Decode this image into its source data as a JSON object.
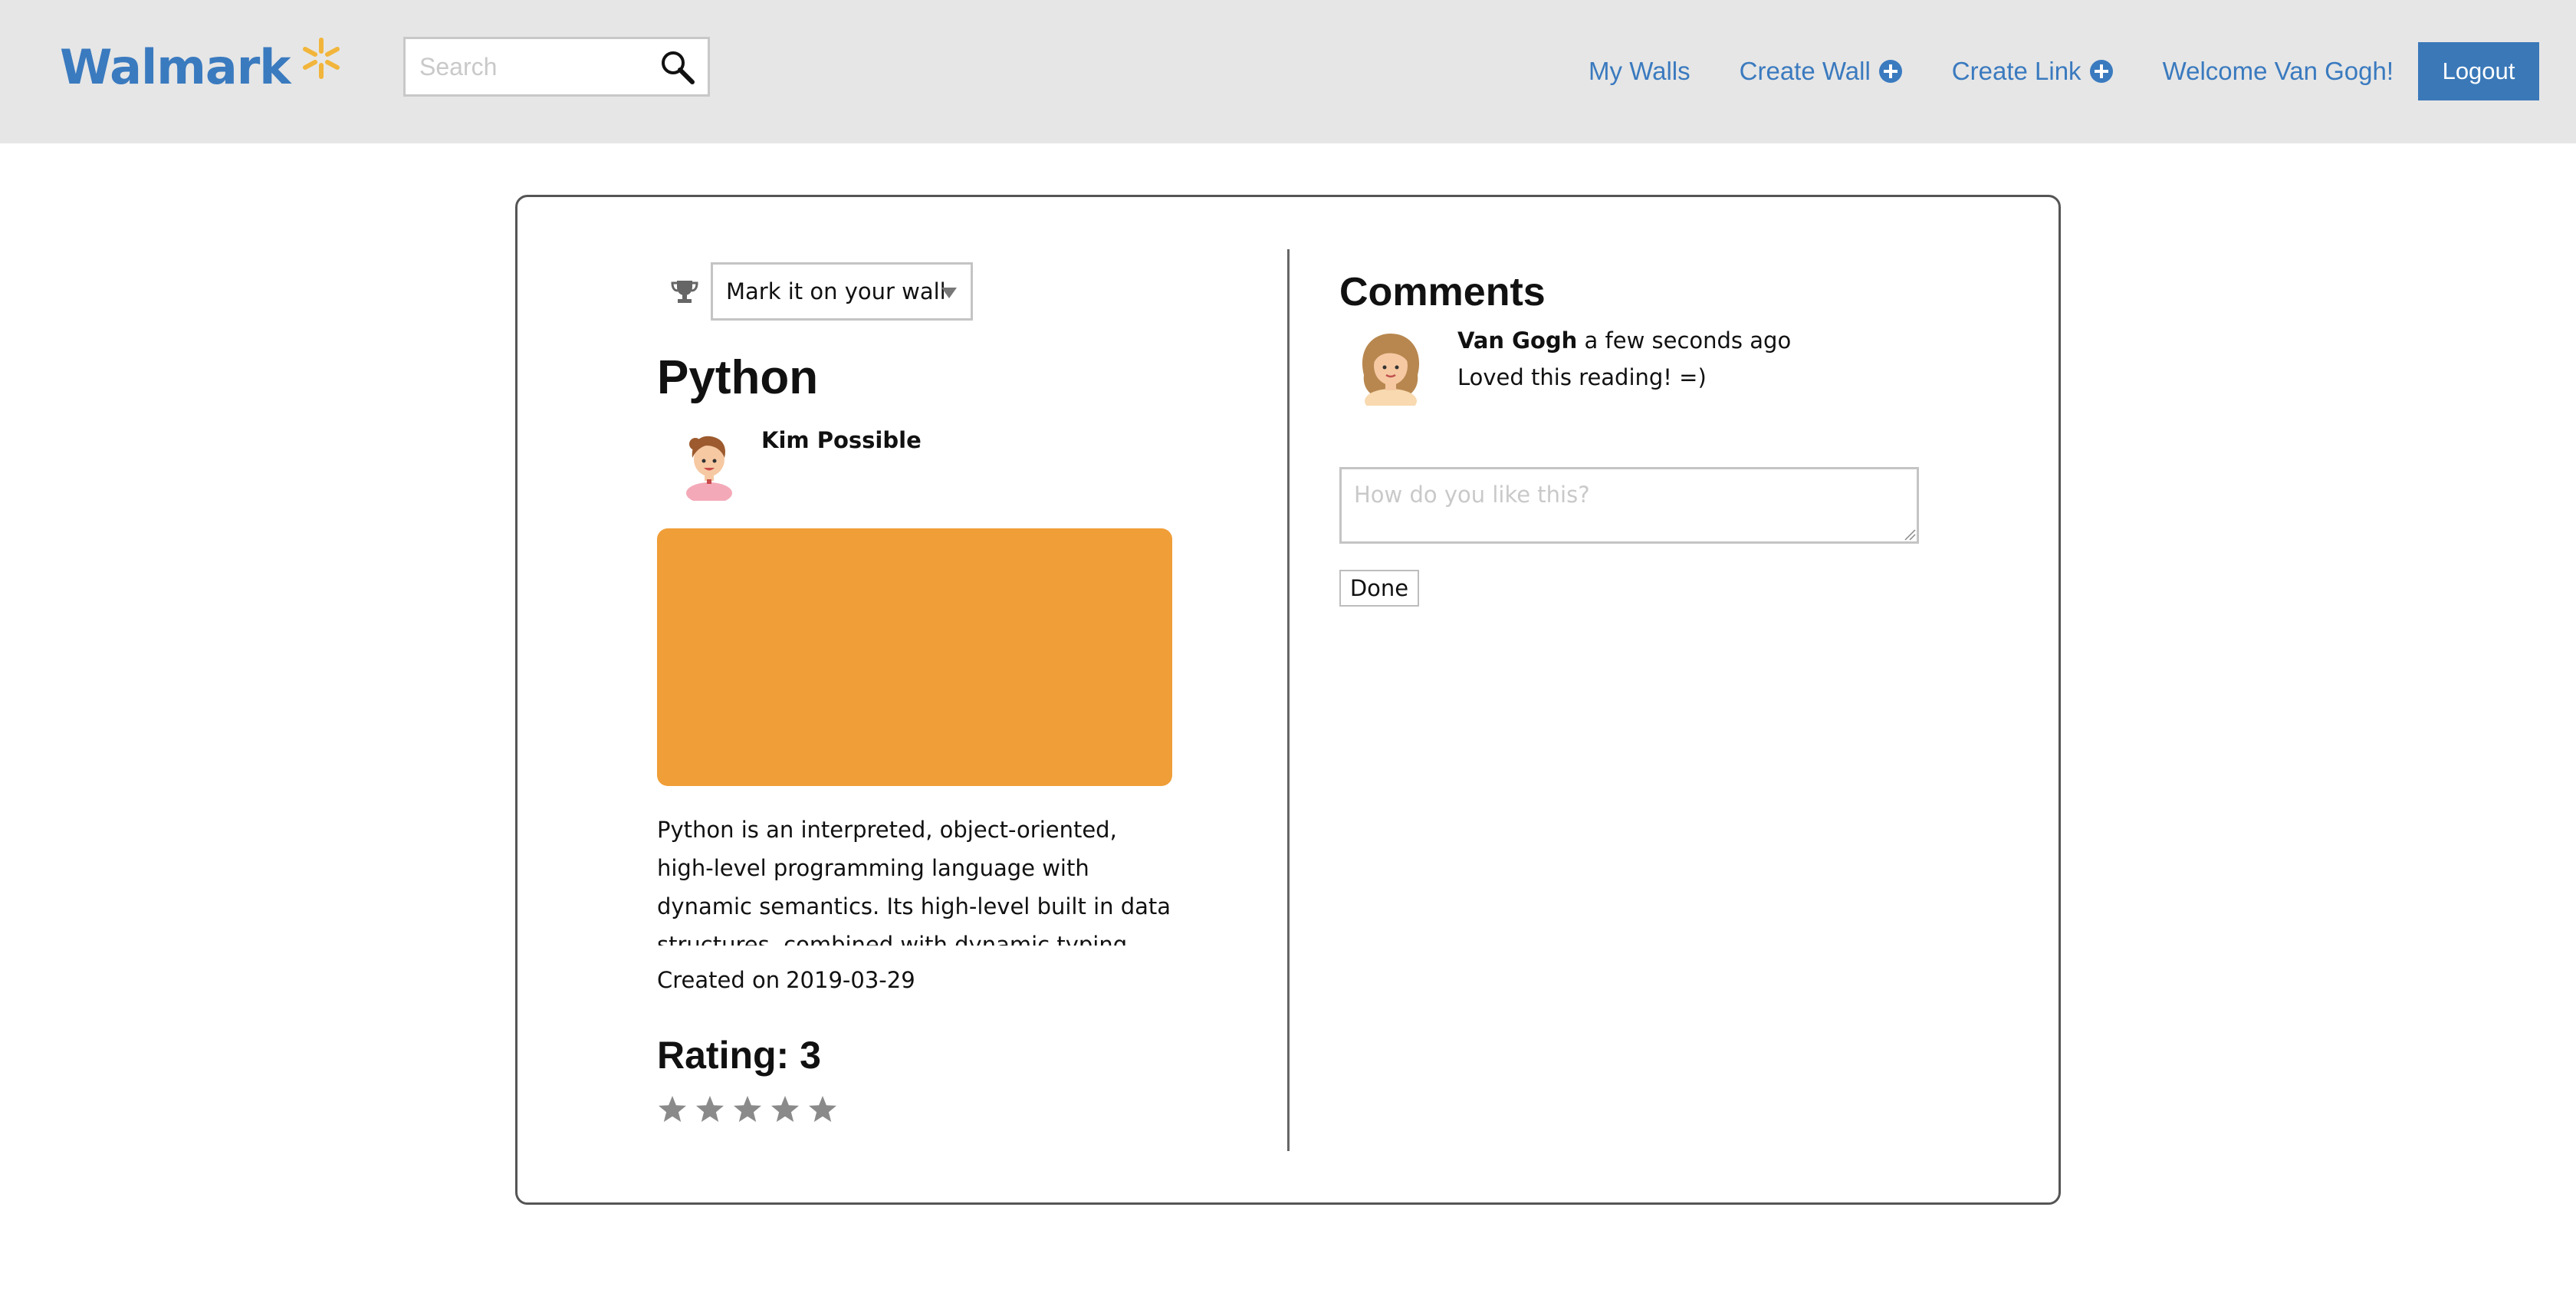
{
  "header": {
    "logo": "Walmark",
    "search": {
      "placeholder": "Search",
      "value": ""
    },
    "nav": {
      "my_walls": "My Walls",
      "create_wall": "Create Wall",
      "create_link": "Create Link",
      "welcome": "Welcome Van Gogh!",
      "logout": "Logout"
    }
  },
  "post": {
    "mark_select": "Mark it on your wall",
    "title": "Python",
    "author": "Kim Possible",
    "thumbnail_color": "#f09e38",
    "description": "Python is an interpreted, object-oriented, high-level programming language with dynamic semantics. Its high-level built in data structures, combined with dynamic typing and dynamic binding, make it very attractive for Rapid Application Development.",
    "created_label": "Created on",
    "created_date": "2019-03-29",
    "rating_label": "Rating: 3",
    "stars_total": 5
  },
  "comments": {
    "title": "Comments",
    "items": [
      {
        "author": "Van Gogh",
        "time": "a few seconds ago",
        "text": "Loved this reading! =)"
      }
    ],
    "input_placeholder": "How do you like this?",
    "done_label": "Done"
  },
  "colors": {
    "brand_blue": "#3a7abf",
    "header_bg": "#e6e6e6",
    "logo_spark": "#f2b53b",
    "star_gray": "#8a8a8a"
  }
}
